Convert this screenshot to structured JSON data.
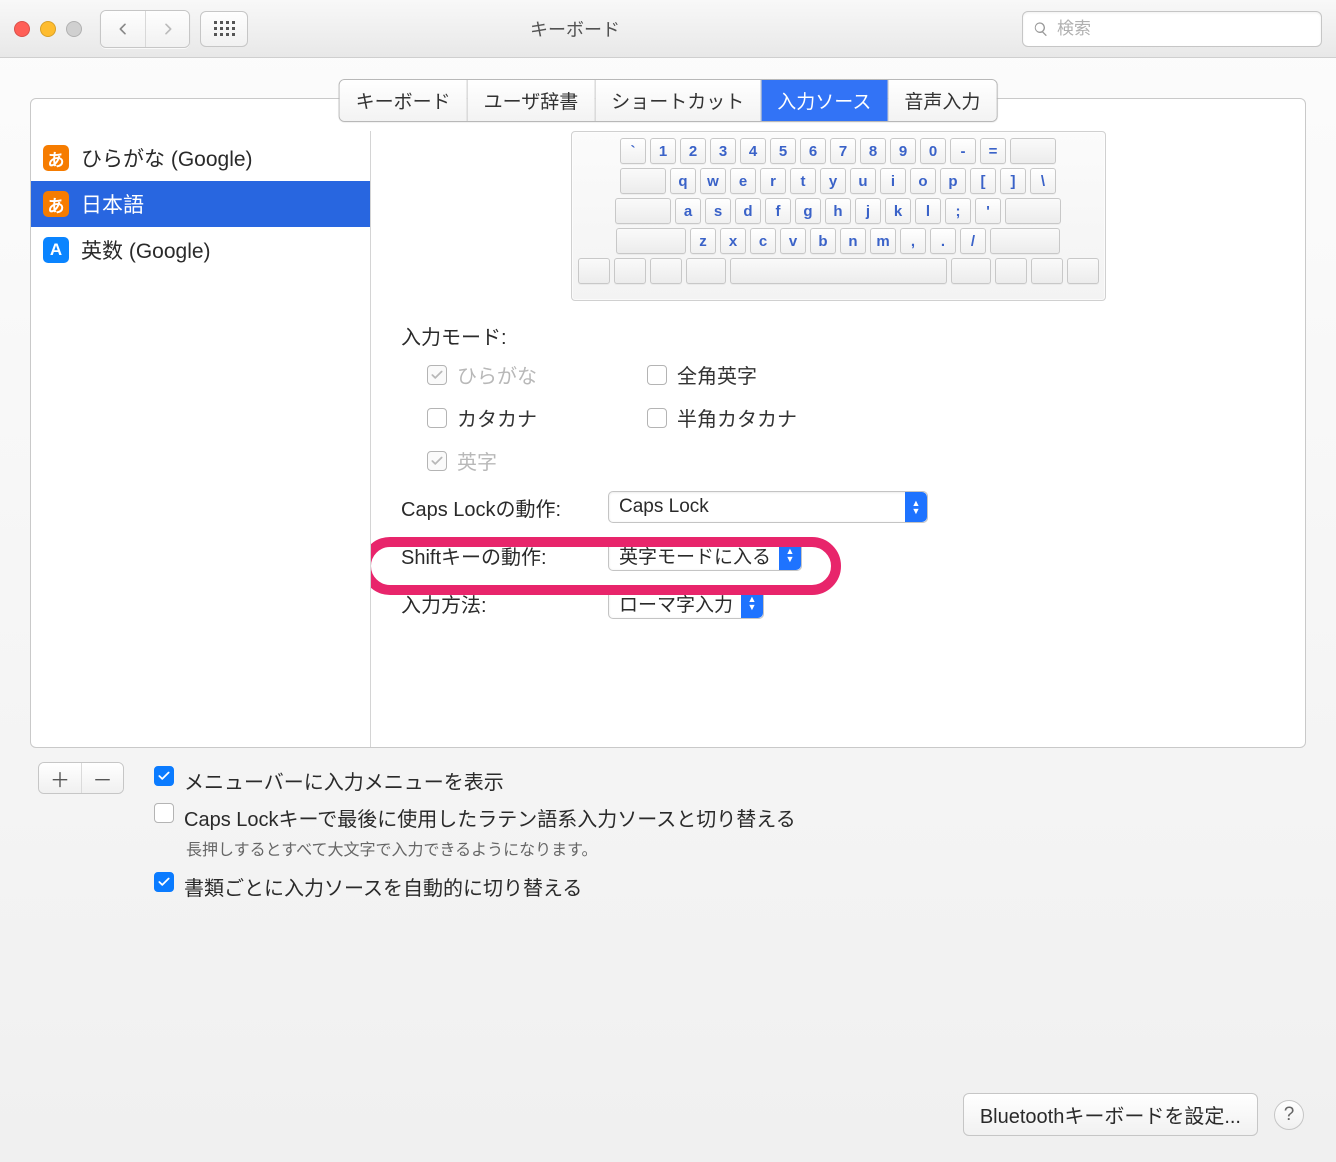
{
  "window": {
    "title": "キーボード"
  },
  "search": {
    "placeholder": "検索"
  },
  "tabs": [
    {
      "label": "キーボード"
    },
    {
      "label": "ユーザ辞書"
    },
    {
      "label": "ショートカット"
    },
    {
      "label": "入力ソース"
    },
    {
      "label": "音声入力"
    }
  ],
  "active_tab_index": 3,
  "sources": [
    {
      "icon": "あ",
      "icon_style": "orange",
      "label": "ひらがな (Google)",
      "selected": false
    },
    {
      "icon": "あ",
      "icon_style": "orange",
      "label": "日本語",
      "selected": true
    },
    {
      "icon": "A",
      "icon_style": "blue",
      "label": "英数 (Google)",
      "selected": false
    }
  ],
  "keyboard_preview": {
    "row1": [
      "`",
      "1",
      "2",
      "3",
      "4",
      "5",
      "6",
      "7",
      "8",
      "9",
      "0",
      "-",
      "="
    ],
    "row2": [
      "q",
      "w",
      "e",
      "r",
      "t",
      "y",
      "u",
      "i",
      "o",
      "p",
      "[",
      "]",
      "\\"
    ],
    "row3": [
      "a",
      "s",
      "d",
      "f",
      "g",
      "h",
      "j",
      "k",
      "l",
      ";",
      "'"
    ],
    "row4": [
      "z",
      "x",
      "c",
      "v",
      "b",
      "n",
      "m",
      ",",
      ".",
      "/"
    ]
  },
  "detail": {
    "input_mode_label": "入力モード:",
    "modes": {
      "hiragana": {
        "label": "ひらがな",
        "checked": true,
        "disabled": true
      },
      "fullwidth_eng": {
        "label": "全角英字",
        "checked": false,
        "disabled": false
      },
      "katakana": {
        "label": "カタカナ",
        "checked": false,
        "disabled": false
      },
      "halfwidth_kata": {
        "label": "半角カタカナ",
        "checked": false,
        "disabled": false
      },
      "eiji": {
        "label": "英字",
        "checked": true,
        "disabled": true
      }
    },
    "capslock_label": "Caps Lockの動作:",
    "capslock_value": "Caps Lock",
    "shiftkey_label": "Shiftキーの動作:",
    "shiftkey_value": "英字モードに入る",
    "input_method_label": "入力方法:",
    "input_method_value": "ローマ字入力"
  },
  "options": {
    "show_menu": {
      "label": "メニューバーに入力メニューを表示",
      "checked": true
    },
    "capslock_switch": {
      "label": "Caps Lockキーで最後に使用したラテン語系入力ソースと切り替える",
      "hint": "長押しするとすべて大文字で入力できるようになります。",
      "checked": false
    },
    "auto_switch": {
      "label": "書類ごとに入力ソースを自動的に切り替える",
      "checked": true
    }
  },
  "footer": {
    "bluetooth_label": "Bluetoothキーボードを設定..."
  }
}
